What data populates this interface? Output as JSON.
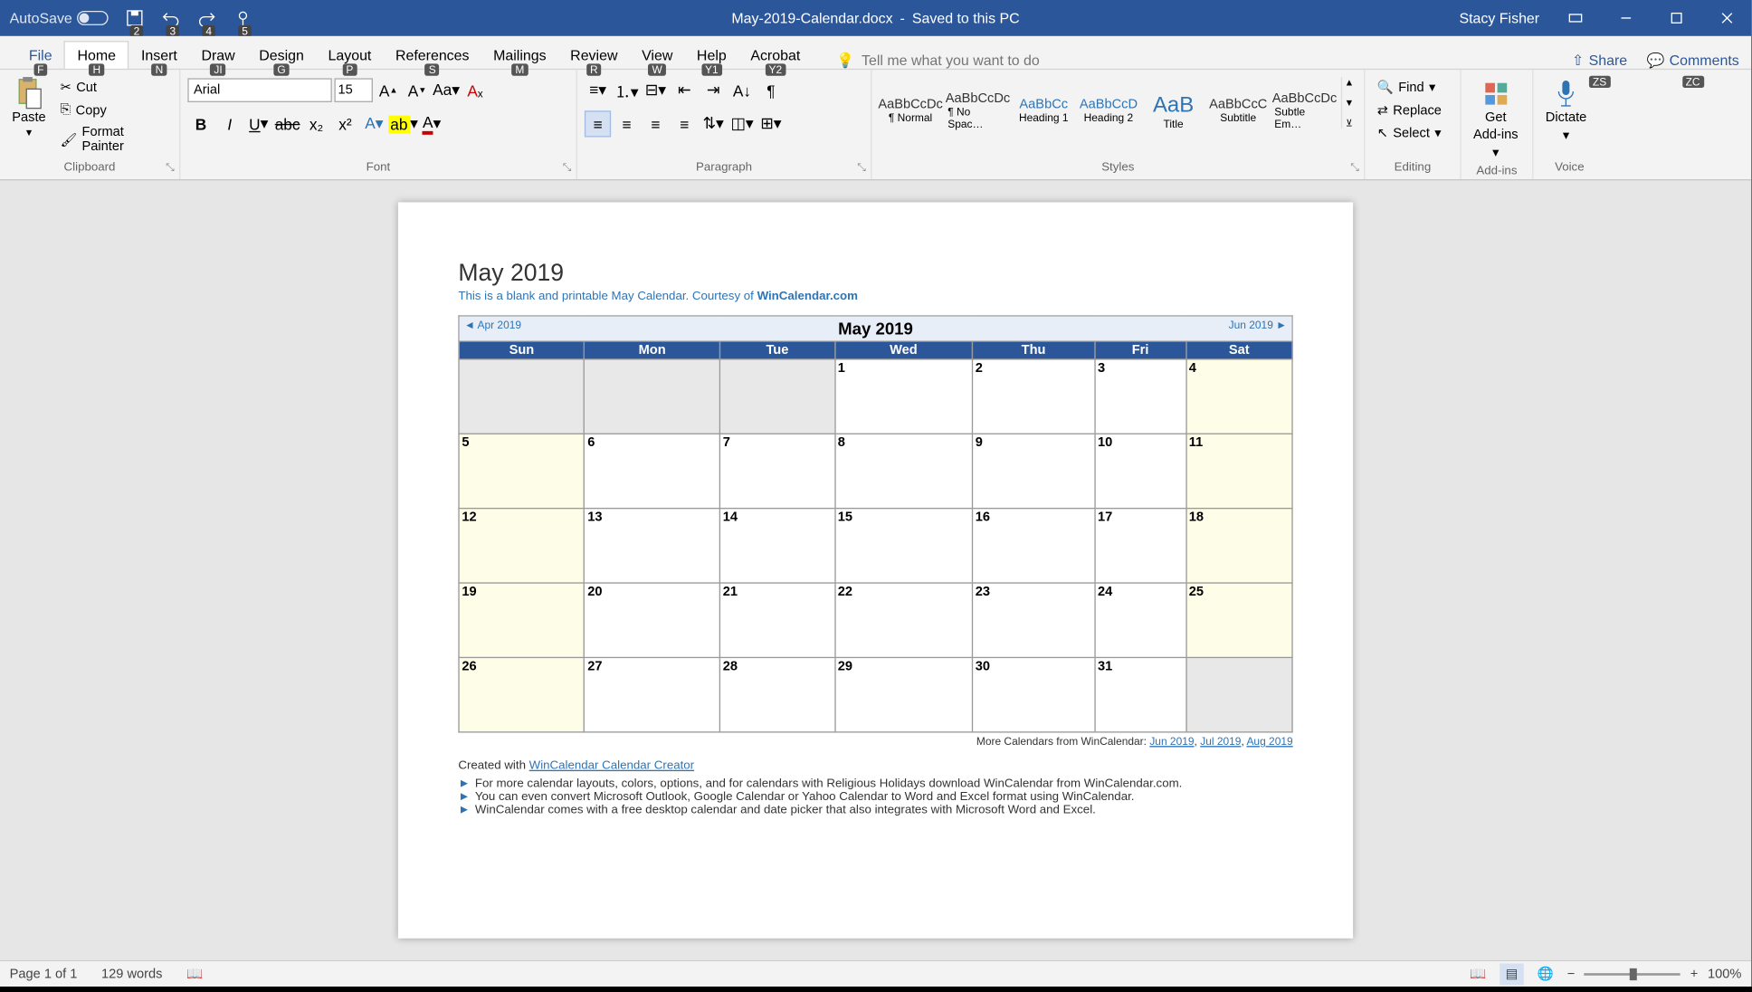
{
  "titlebar": {
    "autosave_label": "AutoSave",
    "doc_title": "May-2019-Calendar.docx",
    "save_status": "Saved to this PC",
    "user": "Stacy Fisher"
  },
  "tabs": {
    "file": "File",
    "home": "Home",
    "insert": "Insert",
    "draw": "Draw",
    "design": "Design",
    "layout": "Layout",
    "references": "References",
    "mailings": "Mailings",
    "review": "Review",
    "view": "View",
    "help": "Help",
    "acrobat": "Acrobat",
    "tellme_placeholder": "Tell me what you want to do",
    "share": "Share",
    "comments": "Comments"
  },
  "keytips": {
    "file": "F",
    "home": "H",
    "insert": "N",
    "draw": "JI",
    "design": "G",
    "layout": "P",
    "references": "S",
    "mailings": "M",
    "review": "R",
    "view": "W",
    "help": "Y1",
    "acrobat": "Y2",
    "share": "ZS",
    "comments": "ZC",
    "q2": "2",
    "q3": "3",
    "q4": "4",
    "q5": "5"
  },
  "clipboard": {
    "group": "Clipboard",
    "paste": "Paste",
    "cut": "Cut",
    "copy": "Copy",
    "format_painter": "Format Painter"
  },
  "font": {
    "group": "Font",
    "name": "Arial",
    "size": "15"
  },
  "paragraph": {
    "group": "Paragraph"
  },
  "styles": {
    "group": "Styles",
    "items": [
      {
        "preview": "AaBbCcDc",
        "label": "¶ Normal",
        "cls": ""
      },
      {
        "preview": "AaBbCcDc",
        "label": "¶ No Spac…",
        "cls": ""
      },
      {
        "preview": "AaBbCc",
        "label": "Heading 1",
        "cls": "h1"
      },
      {
        "preview": "AaBbCcD",
        "label": "Heading 2",
        "cls": "h2"
      },
      {
        "preview": "AaB",
        "label": "Title",
        "cls": "title"
      },
      {
        "preview": "AaBbCcC",
        "label": "Subtitle",
        "cls": ""
      },
      {
        "preview": "AaBbCcDc",
        "label": "Subtle Em…",
        "cls": ""
      }
    ]
  },
  "editing": {
    "group": "Editing",
    "find": "Find",
    "replace": "Replace",
    "select": "Select"
  },
  "addins": {
    "group": "Add-ins",
    "get": "Get",
    "addins": "Add-ins"
  },
  "voice": {
    "group": "Voice",
    "dictate": "Dictate"
  },
  "doc": {
    "title": "May 2019",
    "subtitle_a": "This is a blank and printable May Calendar.  Courtesy of ",
    "subtitle_link": "WinCalendar.com",
    "cal_month": "May   2019",
    "nav_prev": "◄ Apr 2019",
    "nav_next": "Jun 2019 ►",
    "dow": [
      "Sun",
      "Mon",
      "Tue",
      "Wed",
      "Thu",
      "Fri",
      "Sat"
    ],
    "cells": [
      [
        {
          "n": "",
          "c": "grey"
        },
        {
          "n": "",
          "c": "grey"
        },
        {
          "n": "",
          "c": "grey"
        },
        {
          "n": "1",
          "c": ""
        },
        {
          "n": "2",
          "c": ""
        },
        {
          "n": "3",
          "c": ""
        },
        {
          "n": "4",
          "c": "yellow"
        }
      ],
      [
        {
          "n": "5",
          "c": "yellow"
        },
        {
          "n": "6",
          "c": ""
        },
        {
          "n": "7",
          "c": ""
        },
        {
          "n": "8",
          "c": ""
        },
        {
          "n": "9",
          "c": ""
        },
        {
          "n": "10",
          "c": ""
        },
        {
          "n": "11",
          "c": "yellow"
        }
      ],
      [
        {
          "n": "12",
          "c": "yellow"
        },
        {
          "n": "13",
          "c": ""
        },
        {
          "n": "14",
          "c": ""
        },
        {
          "n": "15",
          "c": ""
        },
        {
          "n": "16",
          "c": ""
        },
        {
          "n": "17",
          "c": ""
        },
        {
          "n": "18",
          "c": "yellow"
        }
      ],
      [
        {
          "n": "19",
          "c": "yellow"
        },
        {
          "n": "20",
          "c": ""
        },
        {
          "n": "21",
          "c": ""
        },
        {
          "n": "22",
          "c": ""
        },
        {
          "n": "23",
          "c": ""
        },
        {
          "n": "24",
          "c": ""
        },
        {
          "n": "25",
          "c": "yellow"
        }
      ],
      [
        {
          "n": "26",
          "c": "yellow"
        },
        {
          "n": "27",
          "c": ""
        },
        {
          "n": "28",
          "c": ""
        },
        {
          "n": "29",
          "c": ""
        },
        {
          "n": "30",
          "c": ""
        },
        {
          "n": "31",
          "c": ""
        },
        {
          "n": "",
          "c": "grey"
        }
      ]
    ],
    "more_label": "More Calendars from WinCalendar: ",
    "more_links": [
      "Jun 2019",
      "Jul 2019",
      "Aug 2019"
    ],
    "created_a": "Created with ",
    "created_link": "WinCalendar Calendar Creator",
    "bullets": [
      "For more calendar layouts, colors, options, and for calendars with Religious Holidays download WinCalendar from WinCalendar.com.",
      "You can even convert Microsoft Outlook, Google Calendar or Yahoo Calendar to Word and Excel format using WinCalendar.",
      "WinCalendar comes with a free desktop calendar and date picker that also integrates with Microsoft Word and Excel."
    ]
  },
  "status": {
    "page": "Page 1 of 1",
    "words": "129 words",
    "zoom": "100%"
  }
}
